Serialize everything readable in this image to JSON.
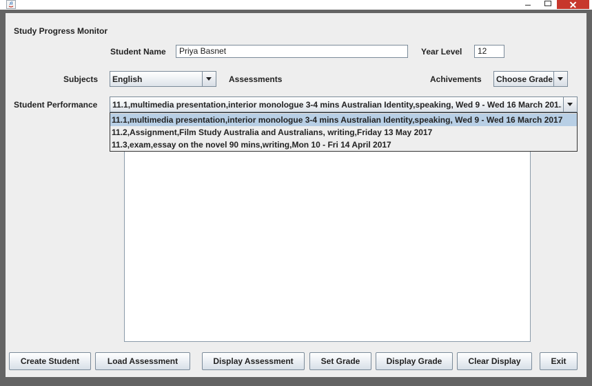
{
  "window": {
    "title": "",
    "controls": {
      "minimize": "minimize",
      "maximize": "maximize",
      "close": "close"
    }
  },
  "header": {
    "app_title": "Study Progress Monitor"
  },
  "student": {
    "name_label": "Student Name",
    "name_value": "Priya Basnet",
    "year_label": "Year Level",
    "year_value": "12"
  },
  "subjects": {
    "label": "Subjects",
    "selected": "English"
  },
  "assessments": {
    "label": "Assessments"
  },
  "achievements": {
    "label": "Achivements",
    "selected": "Choose Grade"
  },
  "performance": {
    "label": "Student Performance",
    "selected": "11.1,multimedia presentation,interior monologue 3-4 mins Australian Identity,speaking, Wed 9 - Wed 16 March 201...",
    "options": [
      "11.1,multimedia presentation,interior monologue 3-4 mins Australian Identity,speaking, Wed 9 - Wed 16 March 2017",
      "11.2,Assignment,Film Study Australia and Australians, writing,Friday 13 May 2017",
      "11.3,exam,essay on the novel 90 mins,writing,Mon 10 - Fri 14 April 2017"
    ]
  },
  "buttons": {
    "create_student": "Create Student",
    "load_assessment": "Load Assessment",
    "display_assessment": "Display Assessment",
    "set_grade": "Set Grade",
    "display_grade": "Display Grade",
    "clear_display": "Clear Display",
    "exit": "Exit"
  },
  "colors": {
    "frame": "#646464",
    "panel": "#eeeeee",
    "selection": "#b8cfe5",
    "close": "#c7372c"
  }
}
